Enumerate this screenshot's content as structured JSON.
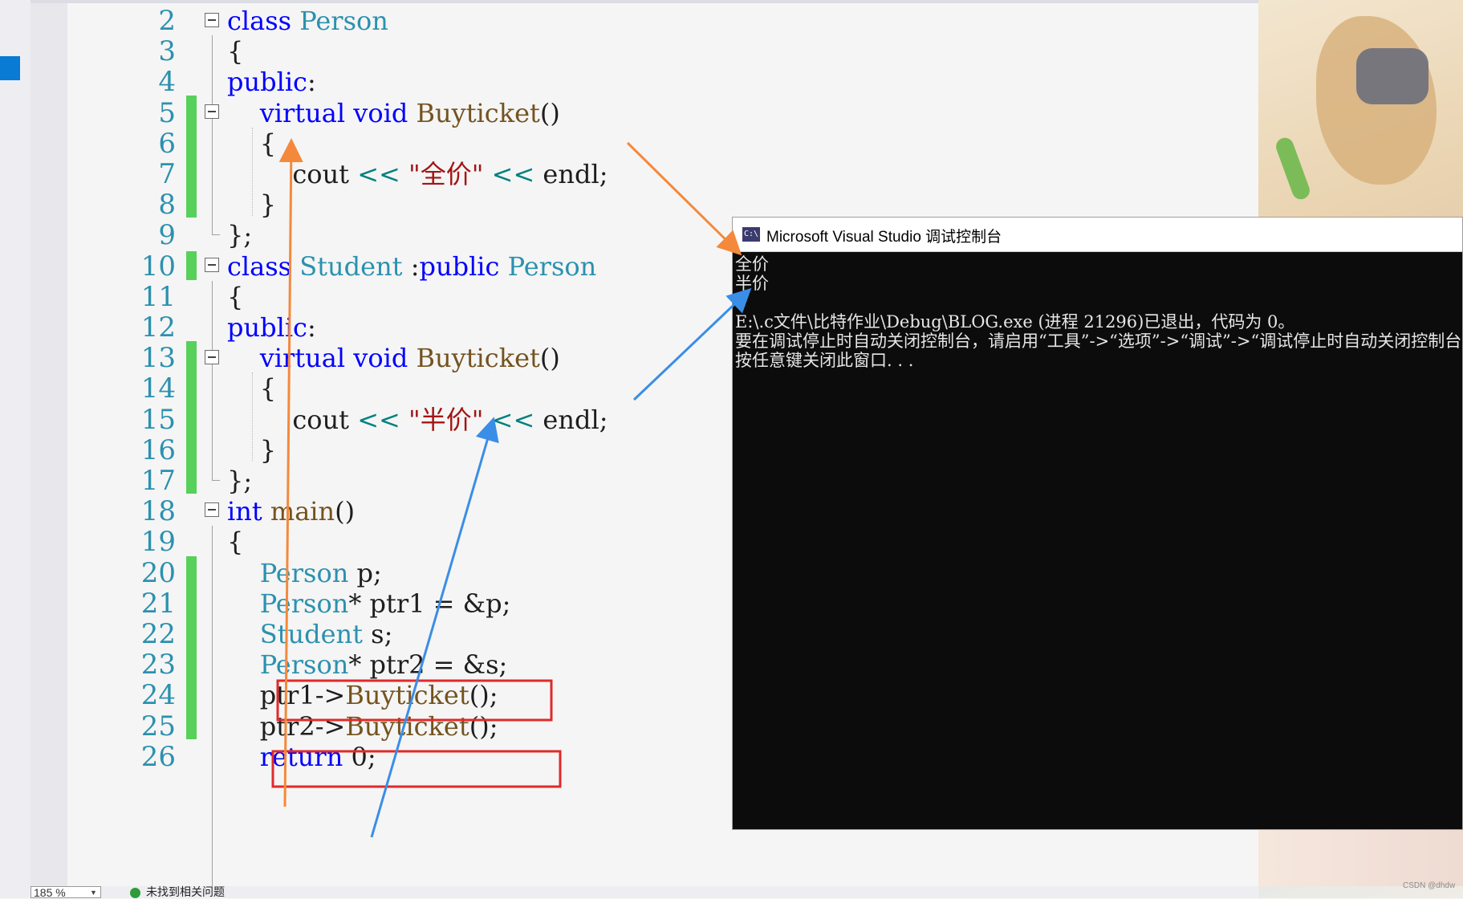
{
  "editor": {
    "lines": [
      {
        "num": "2",
        "tokens": [
          [
            "kw",
            "class "
          ],
          [
            "ty",
            "Person"
          ]
        ]
      },
      {
        "num": "3",
        "tokens": [
          [
            "pl",
            "{"
          ]
        ]
      },
      {
        "num": "4",
        "tokens": [
          [
            "kw",
            "public"
          ],
          [
            "pl",
            ":"
          ]
        ]
      },
      {
        "num": "5",
        "tokens": [
          [
            "pl",
            "    "
          ],
          [
            "kw",
            "virtual void "
          ],
          [
            "fn",
            "Buyticket"
          ],
          [
            "pl",
            "()"
          ]
        ]
      },
      {
        "num": "6",
        "tokens": [
          [
            "pl",
            "    {"
          ]
        ]
      },
      {
        "num": "7",
        "tokens": [
          [
            "pl",
            "        cout "
          ],
          [
            "op",
            "<<"
          ],
          [
            "pl",
            " "
          ],
          [
            "str",
            "\"全价\""
          ],
          [
            "pl",
            " "
          ],
          [
            "op",
            "<<"
          ],
          [
            "pl",
            " endl;"
          ]
        ]
      },
      {
        "num": "8",
        "tokens": [
          [
            "pl",
            "    }"
          ]
        ]
      },
      {
        "num": "9",
        "tokens": [
          [
            "pl",
            "};"
          ]
        ]
      },
      {
        "num": "10",
        "tokens": [
          [
            "kw",
            "class "
          ],
          [
            "ty",
            "Student"
          ],
          [
            "pl",
            " :"
          ],
          [
            "kw",
            "public "
          ],
          [
            "ty",
            "Person"
          ]
        ]
      },
      {
        "num": "11",
        "tokens": [
          [
            "pl",
            "{"
          ]
        ]
      },
      {
        "num": "12",
        "tokens": [
          [
            "kw",
            "public"
          ],
          [
            "pl",
            ":"
          ]
        ]
      },
      {
        "num": "13",
        "tokens": [
          [
            "pl",
            "    "
          ],
          [
            "kw",
            "virtual void "
          ],
          [
            "fn",
            "Buyticket"
          ],
          [
            "pl",
            "()"
          ]
        ]
      },
      {
        "num": "14",
        "tokens": [
          [
            "pl",
            "    {"
          ]
        ]
      },
      {
        "num": "15",
        "tokens": [
          [
            "pl",
            "        cout "
          ],
          [
            "op",
            "<<"
          ],
          [
            "pl",
            " "
          ],
          [
            "str",
            "\"半价\""
          ],
          [
            "pl",
            " "
          ],
          [
            "op",
            "<<"
          ],
          [
            "pl",
            " endl;"
          ]
        ]
      },
      {
        "num": "16",
        "tokens": [
          [
            "pl",
            "    }"
          ]
        ]
      },
      {
        "num": "17",
        "tokens": [
          [
            "pl",
            "};"
          ]
        ]
      },
      {
        "num": "18",
        "tokens": [
          [
            "kw",
            "int "
          ],
          [
            "fn",
            "main"
          ],
          [
            "pl",
            "()"
          ]
        ]
      },
      {
        "num": "19",
        "tokens": [
          [
            "pl",
            "{"
          ]
        ]
      },
      {
        "num": "20",
        "tokens": [
          [
            "pl",
            "    "
          ],
          [
            "ty",
            "Person"
          ],
          [
            "pl",
            " p;"
          ]
        ]
      },
      {
        "num": "21",
        "tokens": [
          [
            "pl",
            "    "
          ],
          [
            "ty",
            "Person"
          ],
          [
            "pl",
            "* ptr1 = &p;"
          ]
        ]
      },
      {
        "num": "22",
        "tokens": [
          [
            "pl",
            "    "
          ],
          [
            "ty",
            "Student"
          ],
          [
            "pl",
            " s;"
          ]
        ]
      },
      {
        "num": "23",
        "tokens": [
          [
            "pl",
            "    "
          ],
          [
            "ty",
            "Person"
          ],
          [
            "pl",
            "* ptr2 = &s;"
          ]
        ]
      },
      {
        "num": "24",
        "tokens": [
          [
            "pl",
            "    ptr1->"
          ],
          [
            "fn",
            "Buyticket"
          ],
          [
            "pl",
            "();"
          ]
        ]
      },
      {
        "num": "25",
        "tokens": [
          [
            "pl",
            "    ptr2->"
          ],
          [
            "fn",
            "Buyticket"
          ],
          [
            "pl",
            "();"
          ]
        ]
      },
      {
        "num": "26",
        "tokens": [
          [
            "pl",
            "    "
          ],
          [
            "kw",
            "return "
          ],
          [
            "pl",
            "0;"
          ]
        ]
      }
    ]
  },
  "console": {
    "title": "Microsoft Visual Studio 调试控制台",
    "icon_text": "C:\\",
    "output": [
      "全价",
      "半价",
      "",
      "E:\\.c文件\\比特作业\\Debug\\BLOG.exe (进程 21296)已退出，代码为 0。",
      "要在调试停止时自动关闭控制台，请启用“工具”->“选项”->“调试”->“调试停止时自动关闭控制台”。",
      "按任意键关闭此窗口. . ."
    ]
  },
  "status": {
    "zoom": "185 %",
    "message": "未找到相关问题"
  },
  "watermark": "CSDN @dhdw",
  "colors": {
    "keyword": "#0000ff",
    "type": "#2b91af",
    "function": "#74531f",
    "string": "#a31515",
    "line_number": "#2b91af",
    "change_bar": "#57d15a",
    "arrow_orange": "#f4893b",
    "arrow_blue": "#3a8ee6",
    "highlight_box": "#e02a2a"
  },
  "icons": [
    "collapse-icon",
    "console-app-icon",
    "check-circle-icon",
    "dropdown-arrow-icon"
  ]
}
